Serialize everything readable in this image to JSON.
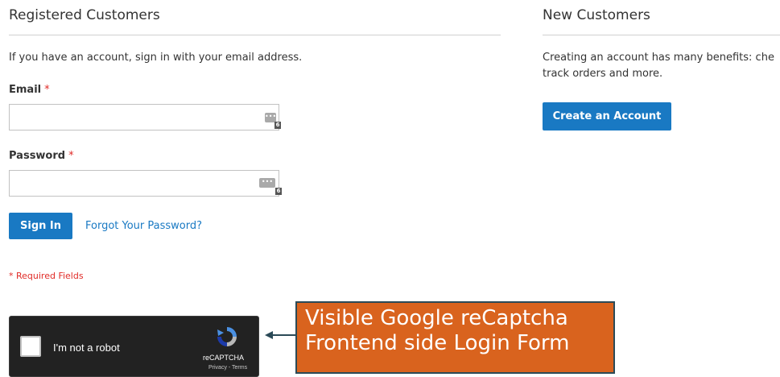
{
  "registered": {
    "title": "Registered Customers",
    "intro": "If you have an account, sign in with your email address.",
    "email_label": "Email",
    "password_label": "Password",
    "required_marker": "*",
    "email_value": "",
    "password_value": "",
    "password_manager_badge": "6",
    "signin_label": "Sign In",
    "forgot_label": "Forgot Your Password?",
    "required_note": "* Required Fields"
  },
  "new_customers": {
    "title": "New Customers",
    "text_line1": "Creating an account has many benefits: che",
    "text_line2": "track orders and more.",
    "create_label": "Create an Account"
  },
  "recaptcha": {
    "checkbox_label": "I'm not a robot",
    "brand": "reCAPTCHA",
    "terms": "Privacy - Terms"
  },
  "annotation": {
    "line1": "Visible Google reCaptcha",
    "line2": "Frontend side Login Form"
  },
  "colors": {
    "primary": "#1979c3",
    "required": "#e02b27",
    "callout_bg": "#d9631e",
    "callout_border": "#2b4a57",
    "captcha_bg": "#222222"
  }
}
